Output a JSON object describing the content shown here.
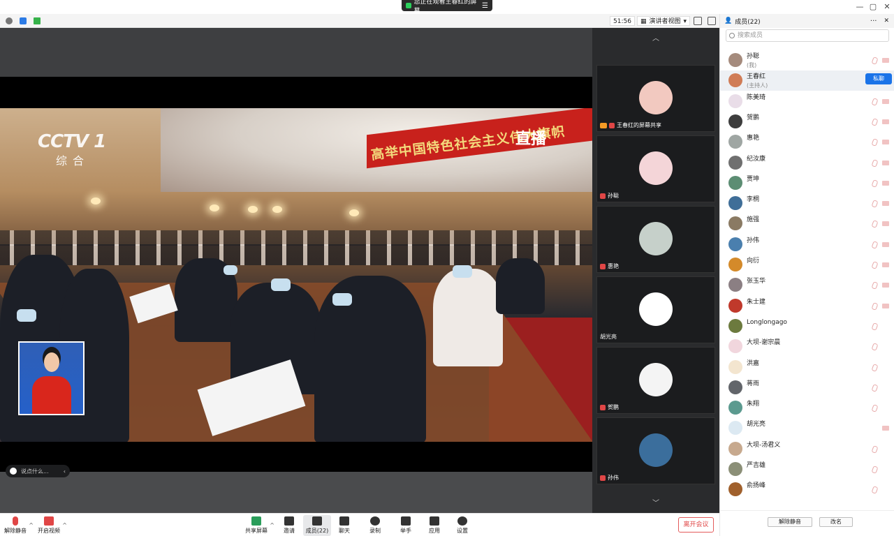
{
  "window": {
    "share_banner": "您正在观看王春红的屏幕",
    "minimize_glyph": "—",
    "restore_glyph": "▢",
    "close_glyph": "✕"
  },
  "meeting_bar": {
    "timer": "51:56",
    "view_mode": "演讲者视图",
    "view_mode_caret": "▾"
  },
  "stage": {
    "broadcast_banner": "高举中国特色社会主义伟大旗帜",
    "live_label": "直播",
    "channel_logo": "CCTV 1",
    "channel_name": "综合",
    "chat_placeholder": "说点什么...",
    "chat_collapse": "‹"
  },
  "strip": {
    "up_arrow": "︿",
    "down_arrow": "﹀",
    "tiles": [
      {
        "name": "王春红的屏幕共享",
        "avatar_color": "#f2c9c0"
      },
      {
        "name": "孙聪",
        "avatar_color": "#f4d5d8"
      },
      {
        "name": "惠艳",
        "avatar_color": "#c6d0ca"
      },
      {
        "name": "胡光亮",
        "avatar_color": "#ffffff"
      },
      {
        "name": "贺鹏",
        "avatar_color": "#f4f4f4"
      },
      {
        "name": "孙伟",
        "avatar_color": "#3b6e9c"
      }
    ]
  },
  "panel": {
    "title": "成员(22)",
    "more": "···",
    "close": "✕",
    "search_placeholder": "搜索成员",
    "dm_button": "私聊",
    "members": [
      {
        "name": "孙聪",
        "role": "(我)",
        "color": "#a58b7d"
      },
      {
        "name": "王春红",
        "role": "(主持人)",
        "color": "#d07c56"
      },
      {
        "name": "陈美琦",
        "role": "",
        "color": "#e9dde8"
      },
      {
        "name": "贺鹏",
        "role": "",
        "color": "#3d3d3d"
      },
      {
        "name": "惠艳",
        "role": "",
        "color": "#9fa6a3"
      },
      {
        "name": "纪汝康",
        "role": "",
        "color": "#6f6f6f"
      },
      {
        "name": "贾坤",
        "role": "",
        "color": "#5c8d73"
      },
      {
        "name": "李桐",
        "role": "",
        "color": "#3f6e98"
      },
      {
        "name": "施强",
        "role": "",
        "color": "#8a7a63"
      },
      {
        "name": "孙伟",
        "role": "",
        "color": "#4a7fae"
      },
      {
        "name": "向衍",
        "role": "",
        "color": "#d48a2a"
      },
      {
        "name": "张玉华",
        "role": "",
        "color": "#8b7f83"
      },
      {
        "name": "朱士建",
        "role": "",
        "color": "#c0392b"
      },
      {
        "name": "Longlongago",
        "role": "",
        "color": "#6c7a3e"
      },
      {
        "name": "大坝-谢宗晨",
        "role": "",
        "color": "#f1d6dd"
      },
      {
        "name": "洪嘉",
        "role": "",
        "color": "#f3e5cf"
      },
      {
        "name": "蒋雨",
        "role": "",
        "color": "#62656a"
      },
      {
        "name": "朱翔",
        "role": "",
        "color": "#5b9a8f"
      },
      {
        "name": "胡光亮",
        "role": "",
        "color": "#dce9f2"
      },
      {
        "name": "大坝-汤君义",
        "role": "",
        "color": "#c7a98e"
      },
      {
        "name": "严吉雄",
        "role": "",
        "color": "#8b8f77"
      },
      {
        "name": "俞扬峰",
        "role": "",
        "color": "#a0602c"
      }
    ],
    "unmute_all": "解除静音",
    "rename": "改名"
  },
  "toolbar": {
    "unmute": "解除静音",
    "start_video": "开启视频",
    "share_screen": "共享屏幕",
    "invite": "邀请",
    "members": "成员(22)",
    "chat": "聊天",
    "record": "录制",
    "raise_hand": "举手",
    "apps": "应用",
    "settings": "设置",
    "leave": "离开会议",
    "caret": "^"
  }
}
